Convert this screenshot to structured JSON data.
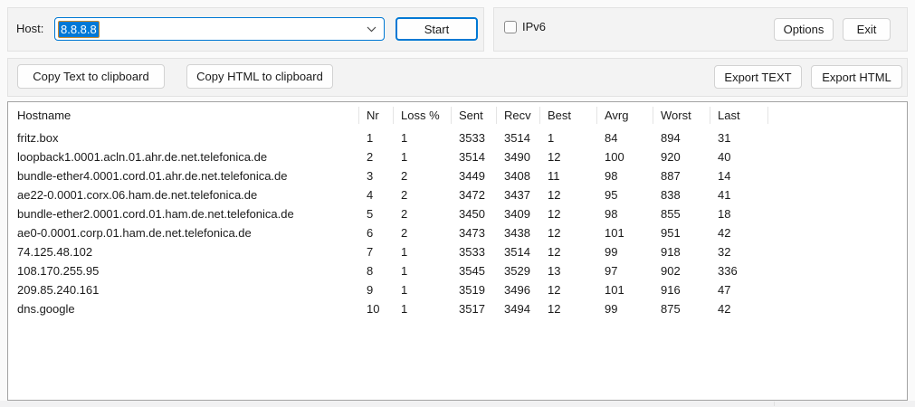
{
  "host_bar": {
    "label": "Host:",
    "value": "8.8.8.8",
    "start": "Start",
    "ipv6": "IPv6",
    "options": "Options",
    "exit": "Exit"
  },
  "actions": {
    "copy_text": "Copy Text to clipboard",
    "copy_html": "Copy HTML to clipboard",
    "export_text": "Export TEXT",
    "export_html": "Export HTML"
  },
  "table": {
    "columns": [
      "Hostname",
      "Nr",
      "Loss %",
      "Sent",
      "Recv",
      "Best",
      "Avrg",
      "Worst",
      "Last"
    ],
    "rows": [
      [
        "fritz.box",
        "1",
        "1",
        "3533",
        "3514",
        "1",
        "84",
        "894",
        "31"
      ],
      [
        "loopback1.0001.acln.01.ahr.de.net.telefonica.de",
        "2",
        "1",
        "3514",
        "3490",
        "12",
        "100",
        "920",
        "40"
      ],
      [
        "bundle-ether4.0001.cord.01.ahr.de.net.telefonica.de",
        "3",
        "2",
        "3449",
        "3408",
        "11",
        "98",
        "887",
        "14"
      ],
      [
        "ae22-0.0001.corx.06.ham.de.net.telefonica.de",
        "4",
        "2",
        "3472",
        "3437",
        "12",
        "95",
        "838",
        "41"
      ],
      [
        "bundle-ether2.0001.cord.01.ham.de.net.telefonica.de",
        "5",
        "2",
        "3450",
        "3409",
        "12",
        "98",
        "855",
        "18"
      ],
      [
        "ae0-0.0001.corp.01.ham.de.net.telefonica.de",
        "6",
        "2",
        "3473",
        "3438",
        "12",
        "101",
        "951",
        "42"
      ],
      [
        "74.125.48.102",
        "7",
        "1",
        "3533",
        "3514",
        "12",
        "99",
        "918",
        "32"
      ],
      [
        "108.170.255.95",
        "8",
        "1",
        "3545",
        "3529",
        "13",
        "97",
        "902",
        "336"
      ],
      [
        "209.85.240.161",
        "9",
        "1",
        "3519",
        "3496",
        "12",
        "101",
        "916",
        "47"
      ],
      [
        "dns.google",
        "10",
        "1",
        "3517",
        "3494",
        "12",
        "99",
        "875",
        "42"
      ]
    ]
  },
  "colors": {
    "accent": "#0078d4",
    "selection_bg": "#0078d7",
    "selection_outline": "#c98a2e"
  }
}
